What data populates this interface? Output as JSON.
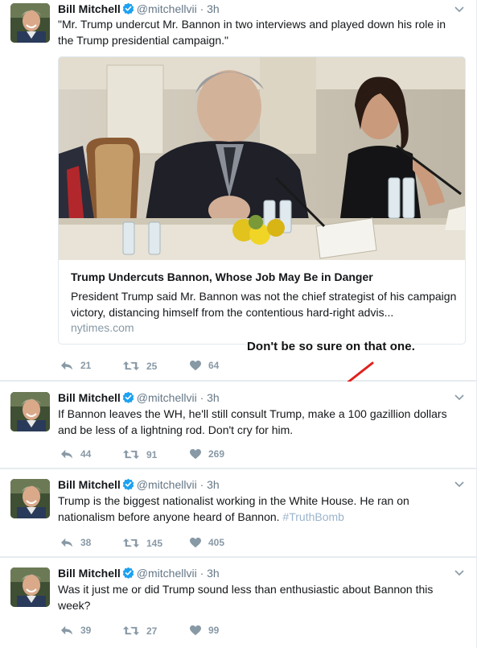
{
  "tweets": [
    {
      "name": "Bill Mitchell",
      "handle": "@mitchellvii",
      "separator": "·",
      "time": "3h",
      "text": "\"Mr. Trump undercut Mr. Bannon in two interviews and played down his role in the Trump presidential campaign.\"",
      "card": {
        "title": "Trump Undercuts Bannon, Whose Job May Be in Danger",
        "description": "President Trump said Mr. Bannon was not the chief strategist of his campaign victory, distancing himself from the contentious hard-right advis...",
        "domain": "nytimes.com"
      },
      "replies": "21",
      "retweets": "25",
      "likes": "64"
    },
    {
      "name": "Bill Mitchell",
      "handle": "@mitchellvii",
      "separator": "·",
      "time": "3h",
      "text": "If Bannon leaves the WH, he'll still consult Trump, make a 100 gazillion dollars and be less of a lightning rod.  Don't cry for him.",
      "replies": "44",
      "retweets": "91",
      "likes": "269"
    },
    {
      "name": "Bill Mitchell",
      "handle": "@mitchellvii",
      "separator": "·",
      "time": "3h",
      "text": "Trump is the biggest nationalist working in the White House. He ran on nationalism before anyone heard of Bannon.",
      "hashtag": "#TruthBomb",
      "replies": "38",
      "retweets": "145",
      "likes": "405"
    },
    {
      "name": "Bill Mitchell",
      "handle": "@mitchellvii",
      "separator": "·",
      "time": "3h",
      "text": "Was it just me or did Trump sound less than enthusiastic about Bannon this week?",
      "replies": "39",
      "retweets": "27",
      "likes": "99"
    }
  ],
  "annotation": {
    "text": "Don't be so sure on that one.",
    "arrow_color": "#e0201c"
  },
  "colors": {
    "verified": "#1da1f2",
    "muted": "#8899a6",
    "hashtag": "#9ab4cc"
  },
  "icons": {
    "reply": "reply-icon",
    "retweet": "retweet-icon",
    "like": "heart-icon",
    "caret": "chevron-down-icon",
    "verified": "verified-badge-icon"
  }
}
